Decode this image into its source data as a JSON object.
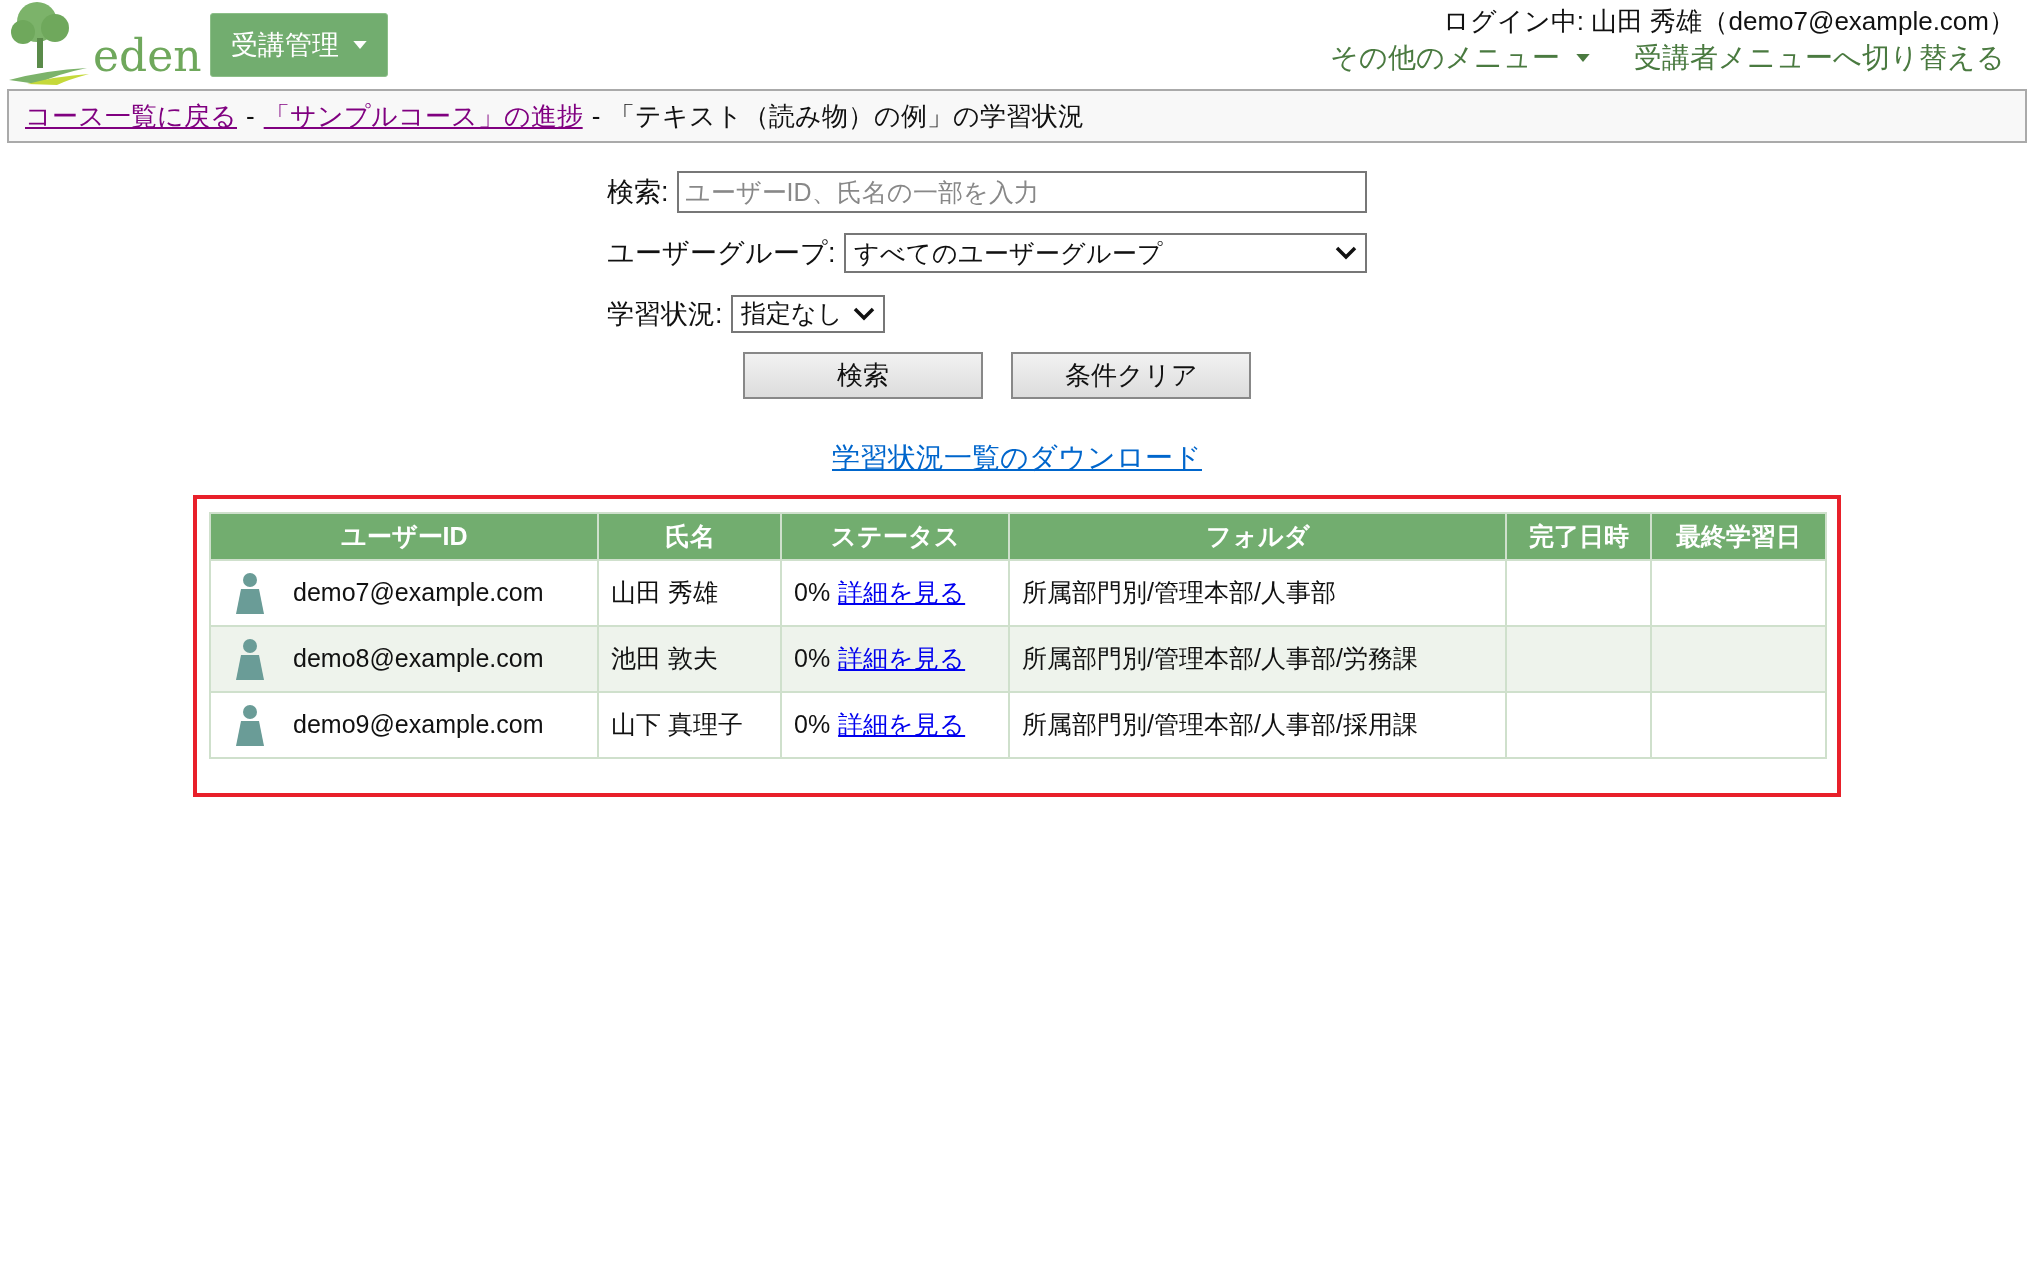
{
  "logo": {
    "text": "eden"
  },
  "admin_menu": {
    "label": "受講管理"
  },
  "header": {
    "login": "ログイン中: 山田 秀雄（demo7@example.com）",
    "other_menu": "その他のメニュー",
    "switch_link": "受講者メニューへ切り替える"
  },
  "breadcrumb": [
    {
      "text": "コース一覧に戻る",
      "kind": "link"
    },
    {
      "text": "-",
      "kind": "separator"
    },
    {
      "text": "「サンプルコース」の進捗",
      "kind": "link"
    },
    {
      "text": "-",
      "kind": "separator"
    },
    {
      "text": "「テキスト（読み物）の例」の学習状況",
      "kind": "current"
    }
  ],
  "search": {
    "label": "検索:",
    "placeholder": "ユーザーID、氏名の一部を入力"
  },
  "user_group": {
    "label": "ユーザーグループ:",
    "value": "すべてのユーザーグループ"
  },
  "study_status": {
    "label": "学習状況:",
    "value": "指定なし"
  },
  "buttons": [
    "検索",
    "条件クリア"
  ],
  "download_link": "学習状況一覧のダウンロード",
  "table": {
    "columns": [
      "ユーザーID",
      "氏名",
      "ステータス",
      "フォルダ",
      "完了日時",
      "最終学習日"
    ],
    "rows": [
      {
        "user_id": "demo7@example.com",
        "name": "山田 秀雄",
        "progress": "0%",
        "detail_link": "詳細を見る",
        "folder": "所属部門別/管理本部/人事部"
      },
      {
        "user_id": "demo8@example.com",
        "name": "池田 敦夫",
        "progress": "0%",
        "detail_link": "詳細を見る",
        "folder": "所属部門別/管理本部/人事部/労務課"
      },
      {
        "user_id": "demo9@example.com",
        "name": "山下 真理子",
        "progress": "0%",
        "detail_link": "詳細を見る",
        "folder": "所属部門別/管理本部/人事部/採用課"
      }
    ]
  }
}
